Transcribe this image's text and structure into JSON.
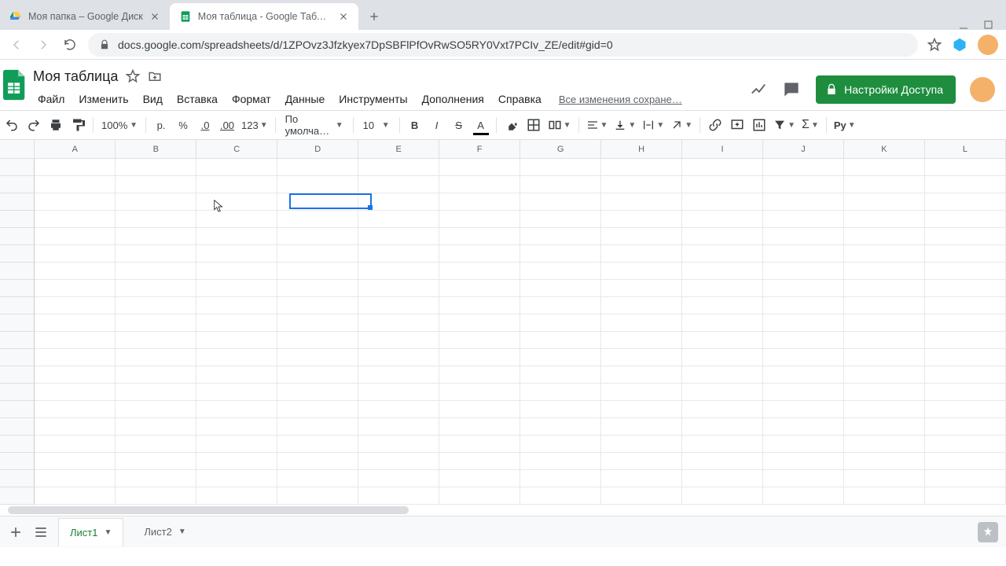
{
  "browser": {
    "tabs": [
      {
        "title": "Моя папка – Google Диск",
        "active": false
      },
      {
        "title": "Моя таблица - Google Таблицы",
        "active": true
      }
    ],
    "url": "docs.google.com/spreadsheets/d/1ZPOvz3Jfzkyex7DpSBFlPfOvRwSO5RY0Vxt7PCIv_ZE/edit#gid=0"
  },
  "doc": {
    "title": "Моя таблица",
    "saved": "Все изменения сохране…"
  },
  "menu": {
    "file": "Файл",
    "edit": "Изменить",
    "view": "Вид",
    "insert": "Вставка",
    "format": "Формат",
    "data": "Данные",
    "tools": "Инструменты",
    "addons": "Дополнения",
    "help": "Справка"
  },
  "toolbar": {
    "zoom": "100%",
    "currency": "р.",
    "percent": "%",
    "dec_minus": ".0",
    "dec_plus": ".00",
    "num_fmt": "123",
    "font": "По умолча…",
    "size": "10",
    "addon_label": "Py"
  },
  "header": {
    "share": "Настройки Доступа"
  },
  "grid": {
    "columns": [
      "A",
      "B",
      "C",
      "D",
      "E",
      "F",
      "G",
      "H",
      "I",
      "J",
      "K",
      "L"
    ],
    "rows": 20,
    "selected_cell": "D3"
  },
  "tabs": {
    "sheet1": "Лист1",
    "sheet2": "Лист2"
  }
}
